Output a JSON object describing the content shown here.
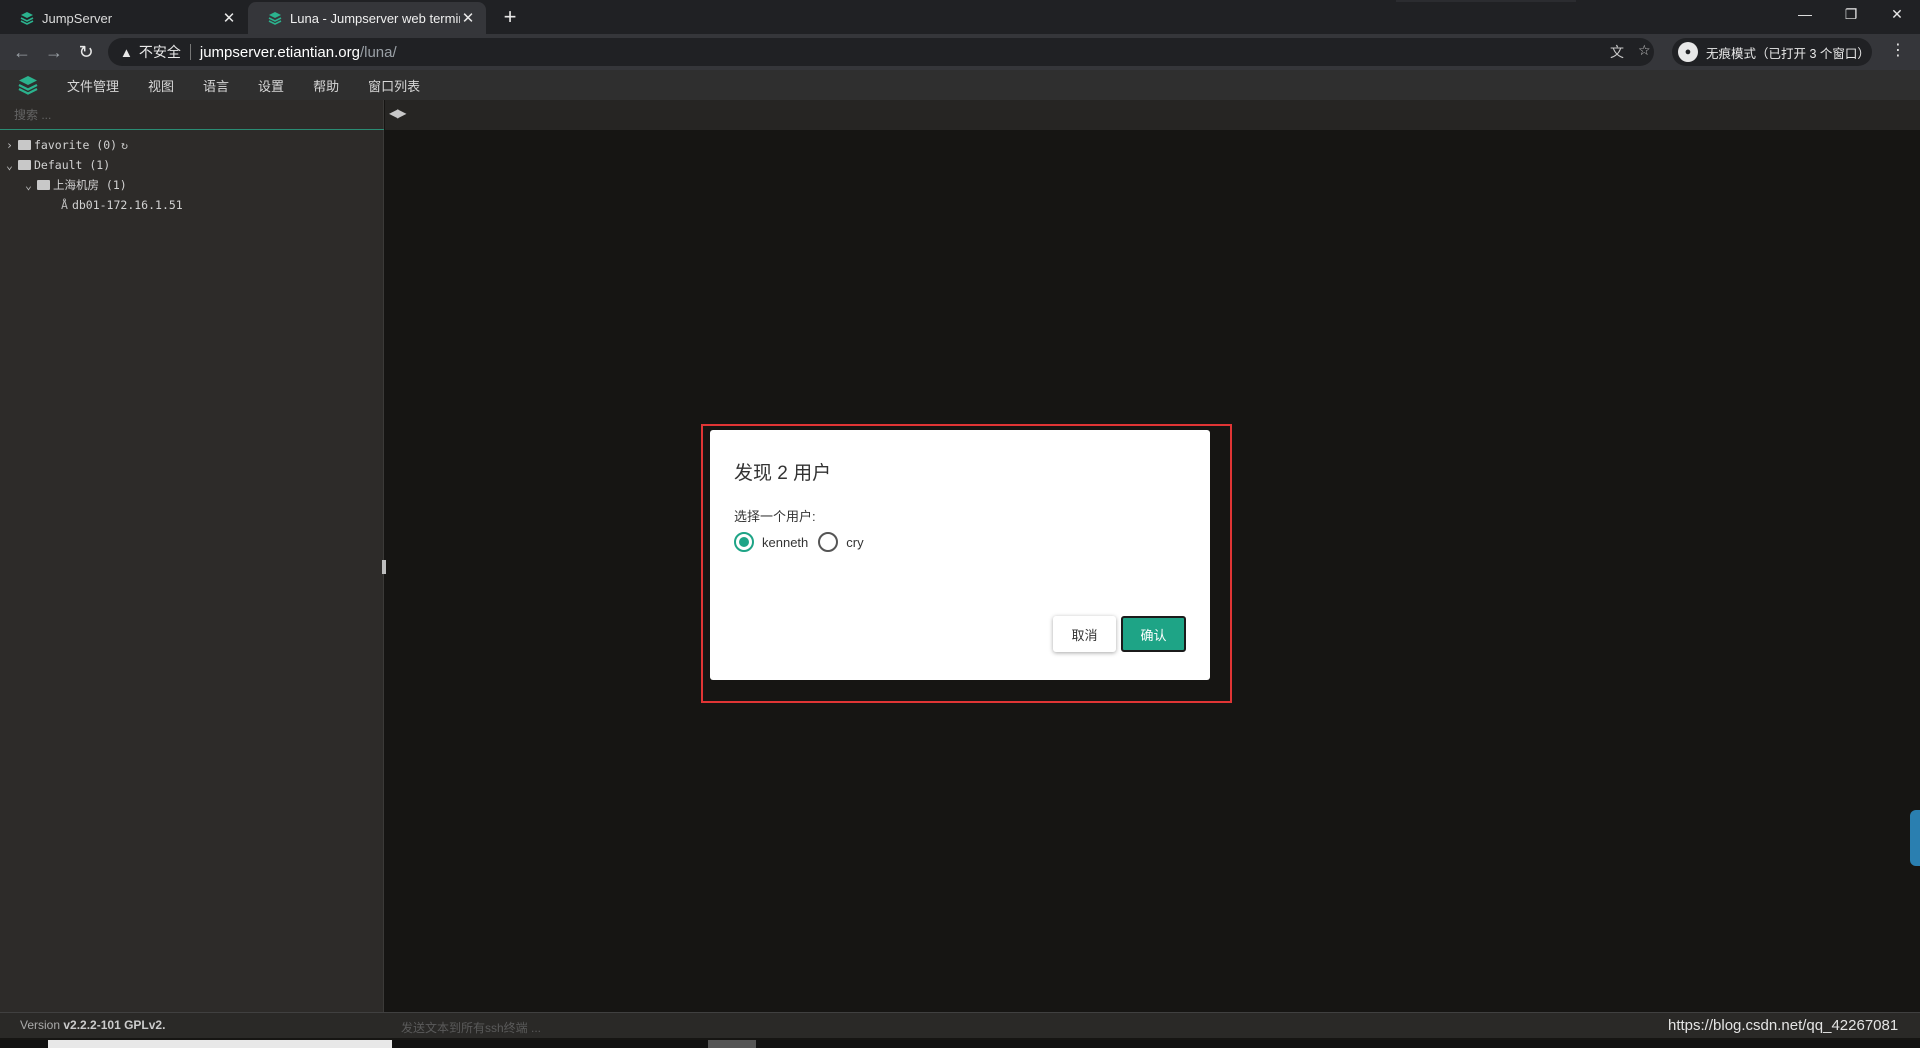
{
  "browser": {
    "tabs": [
      {
        "title": "JumpServer",
        "active": false
      },
      {
        "title": "Luna - Jumpserver web termin",
        "active": true
      }
    ],
    "address": {
      "security_label": "不安全",
      "host": "jumpserver.etiantian.org",
      "path": "/luna/"
    },
    "incognito_label": "无痕模式（已打开 3 个窗口）",
    "accent_color": "#1ea486"
  },
  "app": {
    "menu": [
      "文件管理",
      "视图",
      "语言",
      "设置",
      "帮助",
      "窗口列表"
    ],
    "search_placeholder": "搜索 ...",
    "tree": {
      "favorite": "favorite (0)",
      "default": "Default (1)",
      "room": "上海机房 (1)",
      "asset": "db01-172.16.1.51"
    }
  },
  "dialog": {
    "title": "发现 2 用户",
    "label": "选择一个用户:",
    "options": [
      "kenneth",
      "cry"
    ],
    "selected": "kenneth",
    "cancel": "取消",
    "confirm": "确认"
  },
  "status": {
    "version_prefix": "Version ",
    "version": "v2.2.2-101 GPLv2.",
    "send_placeholder": "发送文本到所有ssh终端 ...",
    "watermark": "https://blog.csdn.net/qq_42267081"
  }
}
